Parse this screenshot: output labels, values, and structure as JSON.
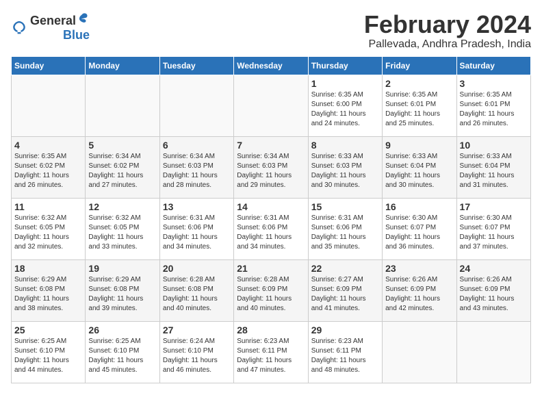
{
  "logo": {
    "text_general": "General",
    "text_blue": "Blue"
  },
  "title": "February 2024",
  "subtitle": "Pallevada, Andhra Pradesh, India",
  "days_of_week": [
    "Sunday",
    "Monday",
    "Tuesday",
    "Wednesday",
    "Thursday",
    "Friday",
    "Saturday"
  ],
  "weeks": [
    [
      {
        "day": "",
        "info": ""
      },
      {
        "day": "",
        "info": ""
      },
      {
        "day": "",
        "info": ""
      },
      {
        "day": "",
        "info": ""
      },
      {
        "day": "1",
        "info": "Sunrise: 6:35 AM\nSunset: 6:00 PM\nDaylight: 11 hours\nand 24 minutes."
      },
      {
        "day": "2",
        "info": "Sunrise: 6:35 AM\nSunset: 6:01 PM\nDaylight: 11 hours\nand 25 minutes."
      },
      {
        "day": "3",
        "info": "Sunrise: 6:35 AM\nSunset: 6:01 PM\nDaylight: 11 hours\nand 26 minutes."
      }
    ],
    [
      {
        "day": "4",
        "info": "Sunrise: 6:35 AM\nSunset: 6:02 PM\nDaylight: 11 hours\nand 26 minutes."
      },
      {
        "day": "5",
        "info": "Sunrise: 6:34 AM\nSunset: 6:02 PM\nDaylight: 11 hours\nand 27 minutes."
      },
      {
        "day": "6",
        "info": "Sunrise: 6:34 AM\nSunset: 6:03 PM\nDaylight: 11 hours\nand 28 minutes."
      },
      {
        "day": "7",
        "info": "Sunrise: 6:34 AM\nSunset: 6:03 PM\nDaylight: 11 hours\nand 29 minutes."
      },
      {
        "day": "8",
        "info": "Sunrise: 6:33 AM\nSunset: 6:03 PM\nDaylight: 11 hours\nand 30 minutes."
      },
      {
        "day": "9",
        "info": "Sunrise: 6:33 AM\nSunset: 6:04 PM\nDaylight: 11 hours\nand 30 minutes."
      },
      {
        "day": "10",
        "info": "Sunrise: 6:33 AM\nSunset: 6:04 PM\nDaylight: 11 hours\nand 31 minutes."
      }
    ],
    [
      {
        "day": "11",
        "info": "Sunrise: 6:32 AM\nSunset: 6:05 PM\nDaylight: 11 hours\nand 32 minutes."
      },
      {
        "day": "12",
        "info": "Sunrise: 6:32 AM\nSunset: 6:05 PM\nDaylight: 11 hours\nand 33 minutes."
      },
      {
        "day": "13",
        "info": "Sunrise: 6:31 AM\nSunset: 6:06 PM\nDaylight: 11 hours\nand 34 minutes."
      },
      {
        "day": "14",
        "info": "Sunrise: 6:31 AM\nSunset: 6:06 PM\nDaylight: 11 hours\nand 34 minutes."
      },
      {
        "day": "15",
        "info": "Sunrise: 6:31 AM\nSunset: 6:06 PM\nDaylight: 11 hours\nand 35 minutes."
      },
      {
        "day": "16",
        "info": "Sunrise: 6:30 AM\nSunset: 6:07 PM\nDaylight: 11 hours\nand 36 minutes."
      },
      {
        "day": "17",
        "info": "Sunrise: 6:30 AM\nSunset: 6:07 PM\nDaylight: 11 hours\nand 37 minutes."
      }
    ],
    [
      {
        "day": "18",
        "info": "Sunrise: 6:29 AM\nSunset: 6:08 PM\nDaylight: 11 hours\nand 38 minutes."
      },
      {
        "day": "19",
        "info": "Sunrise: 6:29 AM\nSunset: 6:08 PM\nDaylight: 11 hours\nand 39 minutes."
      },
      {
        "day": "20",
        "info": "Sunrise: 6:28 AM\nSunset: 6:08 PM\nDaylight: 11 hours\nand 40 minutes."
      },
      {
        "day": "21",
        "info": "Sunrise: 6:28 AM\nSunset: 6:09 PM\nDaylight: 11 hours\nand 40 minutes."
      },
      {
        "day": "22",
        "info": "Sunrise: 6:27 AM\nSunset: 6:09 PM\nDaylight: 11 hours\nand 41 minutes."
      },
      {
        "day": "23",
        "info": "Sunrise: 6:26 AM\nSunset: 6:09 PM\nDaylight: 11 hours\nand 42 minutes."
      },
      {
        "day": "24",
        "info": "Sunrise: 6:26 AM\nSunset: 6:09 PM\nDaylight: 11 hours\nand 43 minutes."
      }
    ],
    [
      {
        "day": "25",
        "info": "Sunrise: 6:25 AM\nSunset: 6:10 PM\nDaylight: 11 hours\nand 44 minutes."
      },
      {
        "day": "26",
        "info": "Sunrise: 6:25 AM\nSunset: 6:10 PM\nDaylight: 11 hours\nand 45 minutes."
      },
      {
        "day": "27",
        "info": "Sunrise: 6:24 AM\nSunset: 6:10 PM\nDaylight: 11 hours\nand 46 minutes."
      },
      {
        "day": "28",
        "info": "Sunrise: 6:23 AM\nSunset: 6:11 PM\nDaylight: 11 hours\nand 47 minutes."
      },
      {
        "day": "29",
        "info": "Sunrise: 6:23 AM\nSunset: 6:11 PM\nDaylight: 11 hours\nand 48 minutes."
      },
      {
        "day": "",
        "info": ""
      },
      {
        "day": "",
        "info": ""
      }
    ]
  ]
}
